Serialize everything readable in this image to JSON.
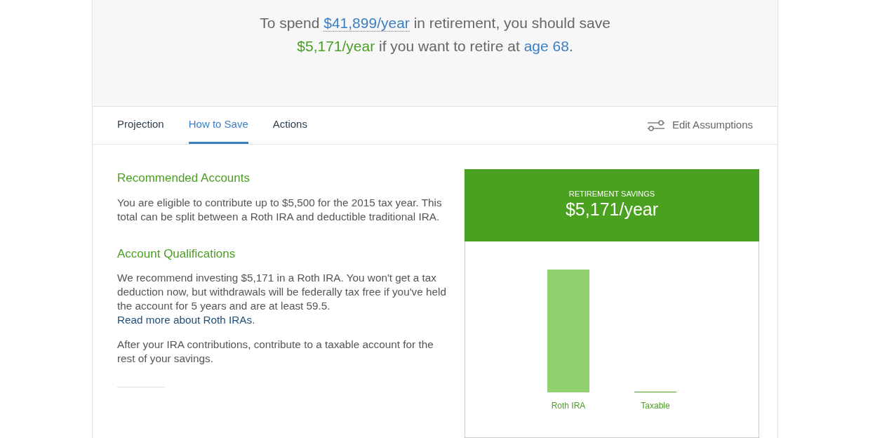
{
  "headline": [
    {
      "kind": "plain",
      "text": "To spend "
    },
    {
      "kind": "dotted-link",
      "text": "$41,899/year"
    },
    {
      "kind": "plain",
      "text": " in retirement, you should save"
    },
    {
      "kind": "break"
    },
    {
      "kind": "green",
      "text": "$5,171/year"
    },
    {
      "kind": "plain",
      "text": " if you want to retire at "
    },
    {
      "kind": "link",
      "text": "age 68"
    },
    {
      "kind": "plain",
      "text": "."
    }
  ],
  "tabs": [
    {
      "label": "Projection",
      "selected": false
    },
    {
      "label": "How to Save",
      "selected": true
    },
    {
      "label": "Actions",
      "selected": false
    }
  ],
  "edit_assumptions": "Edit Assumptions",
  "sections": [
    {
      "title": "Recommended Accounts",
      "paragraphs": [
        [
          {
            "kind": "plain",
            "text": "You are eligible to contribute up to $5,500 for the 2015 tax year. This total can be split between a Roth IRA and deductible traditional IRA."
          }
        ]
      ]
    },
    {
      "title": "Account Qualifications",
      "paragraphs": [
        [
          {
            "kind": "plain",
            "text": "We recommend investing $5,171 in a Roth IRA. You won't get a tax deduction now, but withdrawals will be federally tax free if you've held the account for 5 years and are at least 59.5. "
          },
          {
            "kind": "link",
            "text": "Read more about Roth IRAs"
          },
          {
            "kind": "plain",
            "text": "."
          }
        ],
        [
          {
            "kind": "plain",
            "text": "After your IRA contributions, contribute to a taxable account for the rest of your savings."
          }
        ]
      ]
    }
  ],
  "savings_panel": {
    "label": "RETIREMENT SAVINGS",
    "amount": "$5,171/year",
    "accounts": [
      {
        "name": "Roth IRA",
        "kind": "full"
      },
      {
        "name": "Taxable",
        "kind": "empty"
      }
    ]
  }
}
